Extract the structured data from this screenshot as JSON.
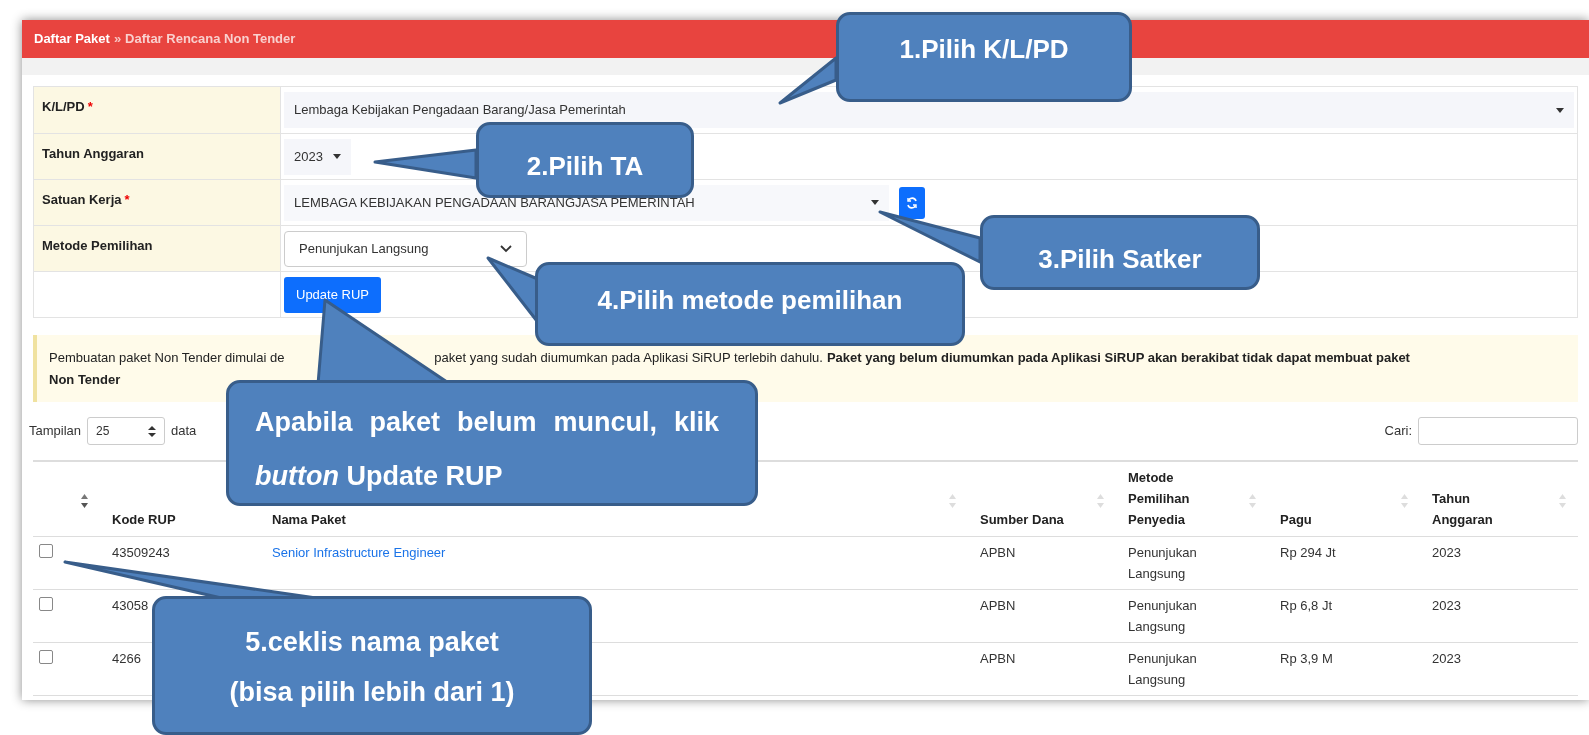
{
  "breadcrumb": {
    "items": [
      {
        "label": "Daftar Paket",
        "current": false
      },
      {
        "label": "Daftar Rencana Non Tender",
        "current": true
      }
    ],
    "separator": "»"
  },
  "form": {
    "rows": [
      {
        "kind": "select-wide",
        "label": "K/L/PD",
        "required_mark": "*",
        "value": "Lembaga Kebijakan Pengadaan Barang/Jasa Pemerintah"
      },
      {
        "kind": "select-small",
        "label": "Tahun Anggaran",
        "value": "2023"
      },
      {
        "kind": "select-refresh",
        "label": "Satuan Kerja",
        "required_mark": "*",
        "value": "LEMBAGA KEBIJAKAN PENGADAAN BARANGJASA PEMERINTAH"
      },
      {
        "kind": "select-native",
        "label": "Metode Pemilihan",
        "value": "Penunjukan Langsung"
      },
      {
        "kind": "button",
        "value": "Update RUP"
      }
    ]
  },
  "notice": {
    "parts": [
      "Pembuatan paket Non Tender dimulai de",
      "paket yang sudah diumumkan pada Aplikasi SiRUP terlebih dahulu.",
      "Paket yang belum diumumkan pada Aplikasi SiRUP akan berakibat tidak dapat membuat paket",
      "Non Tender"
    ]
  },
  "length": {
    "label": "Tampilan",
    "value": "25",
    "suffix": "data"
  },
  "search": {
    "label": "Cari:"
  },
  "table": {
    "columns": [
      {
        "sorted": true
      },
      {
        "label": "Kode RUP"
      },
      {
        "label": "Nama Paket",
        "sorted": false
      },
      {
        "label": "Sumber Dana",
        "sorted": false
      },
      {
        "label": "Metode Pemilihan Penyedia",
        "sorted": false
      },
      {
        "label": "Pagu",
        "sorted": false
      },
      {
        "label": "Tahun Anggaran",
        "sorted": false
      }
    ],
    "rows": [
      {
        "checked": false,
        "kode": "43509243",
        "nama": "Senior Infrastructure Engineer",
        "sumber": "APBN",
        "metode": "Penunjukan Langsung",
        "pagu": "Rp 294 Jt",
        "tahun": "2023"
      },
      {
        "checked": false,
        "kode": "43058",
        "sumber": "APBN",
        "metode": "Penunjukan Langsung",
        "pagu": "Rp 6,8 Jt",
        "tahun": "2023"
      },
      {
        "checked": false,
        "kode": "4266",
        "sumber": "APBN",
        "metode": "Penunjukan Langsung",
        "pagu": "Rp 3,9 M",
        "tahun": "2023"
      }
    ]
  },
  "callouts": [
    {
      "lines": [
        "1.Pilih K/L/PD"
      ]
    },
    {
      "lines": [
        "2.Pilih TA"
      ]
    },
    {
      "lines": [
        "3.Pilih Satker"
      ]
    },
    {
      "lines": [
        "4.Pilih metode pemilihan"
      ]
    },
    {
      "lines": [
        "Apabila paket belum muncul, klik *button* Update RUP"
      ]
    },
    {
      "lines": [
        "5.ceklis nama paket",
        "(bisa pilih lebih dari 1)"
      ]
    }
  ]
}
